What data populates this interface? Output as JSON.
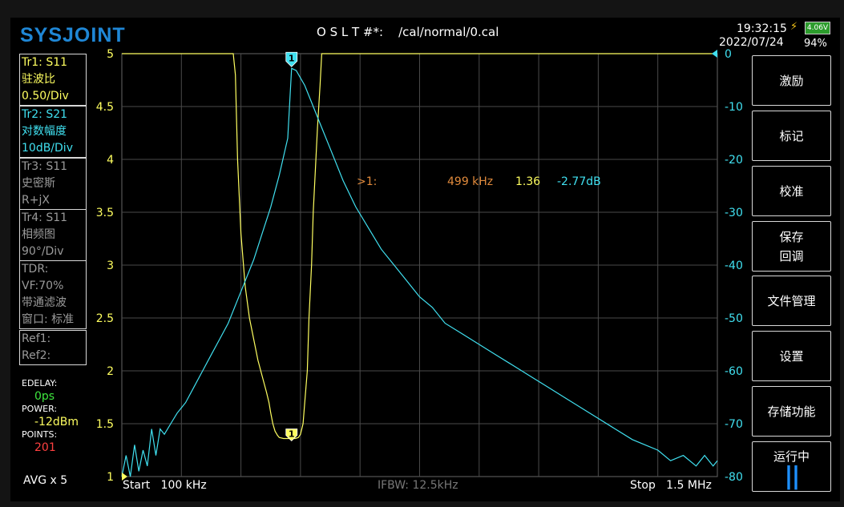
{
  "header": {
    "logo": "SYSJOINT",
    "cal_title": "O S L T #*:    /cal/normal/0.cal",
    "time": "19:32:15",
    "date": "2022/07/24",
    "battery_voltage": "4.06V",
    "battery_percent": "94%"
  },
  "traces": [
    {
      "lines": [
        "Tr1:   S11",
        "驻波比",
        "0.50/Div"
      ],
      "color": "yellow"
    },
    {
      "lines": [
        "Tr2:   S21",
        "对数幅度",
        "10dB/Div"
      ],
      "color": "cyan"
    },
    {
      "lines": [
        "Tr3:   S11",
        "史密斯",
        "R+jX"
      ],
      "color": "grey"
    },
    {
      "lines": [
        "Tr4:   S11",
        "相频图",
        "90°/Div"
      ],
      "color": "grey"
    },
    {
      "lines": [
        "TDR:",
        "VF:70%",
        "带通滤波",
        "窗口: 标准"
      ],
      "color": "grey"
    },
    {
      "lines": [
        "Ref1:",
        "Ref2:"
      ],
      "color": "grey"
    }
  ],
  "settings": {
    "edelay_label": "EDELAY:",
    "edelay_value": "0ps",
    "power_label": "POWER:",
    "power_value": "-12dBm",
    "points_label": "POINTS:",
    "points_value": "201",
    "avg": "AVG x 5"
  },
  "menu": [
    {
      "label": "激励"
    },
    {
      "label": "标记"
    },
    {
      "label": "校准"
    },
    {
      "label": "保存\n回调"
    },
    {
      "label": "文件管理"
    },
    {
      "label": "设置"
    },
    {
      "label": "存储功能"
    },
    {
      "label": "运行中"
    }
  ],
  "run_icon": "pause-icon",
  "footer": {
    "start": "Start   100 kHz",
    "ifbw": "IFBW: 12.5kHz",
    "stop": "Stop   1.5 MHz"
  },
  "chart_data": {
    "type": "line",
    "x_unit": "kHz",
    "xlim": [
      100,
      1500
    ],
    "left_axis": {
      "ticks": [
        "5",
        "4.5",
        "4",
        "3.5",
        "3",
        "2.5",
        "2",
        "1.5",
        "1"
      ],
      "ylim": [
        1,
        5
      ],
      "color": "#ffff60"
    },
    "right_axis": {
      "ticks": [
        "0",
        "-10",
        "-20",
        "-30",
        "-40",
        "-50",
        "-60",
        "-70",
        "-80"
      ],
      "ylim": [
        -80,
        0
      ],
      "color": "#40e0f0"
    },
    "grid": true,
    "series": [
      {
        "name": "Tr1",
        "axis": "left",
        "color": "#ffff60",
        "x": [
          100,
          320,
          355,
          362,
          367,
          372,
          380,
          390,
          400,
          410,
          420,
          430,
          440,
          446,
          450,
          455,
          460,
          466,
          470,
          480,
          490,
          499,
          508,
          515,
          520,
          526,
          530,
          536,
          540,
          546,
          550,
          560,
          566,
          570,
          574,
          580,
          1500
        ],
        "y": [
          5,
          5,
          5,
          5,
          4.8,
          4.0,
          3.3,
          2.8,
          2.5,
          2.3,
          2.1,
          1.95,
          1.8,
          1.7,
          1.6,
          1.5,
          1.43,
          1.39,
          1.37,
          1.36,
          1.36,
          1.36,
          1.36,
          1.37,
          1.4,
          1.5,
          1.7,
          2.0,
          2.5,
          3.0,
          3.5,
          4.3,
          4.7,
          5,
          5,
          5,
          5
        ]
      },
      {
        "name": "Tr2",
        "axis": "right",
        "color": "#40e0f0",
        "x": [
          100,
          110,
          120,
          130,
          140,
          150,
          160,
          170,
          180,
          190,
          200,
          215,
          230,
          250,
          270,
          290,
          310,
          330,
          350,
          370,
          390,
          410,
          430,
          450,
          470,
          490,
          499,
          510,
          530,
          550,
          570,
          590,
          620,
          650,
          680,
          710,
          740,
          770,
          800,
          830,
          860,
          900,
          940,
          980,
          1020,
          1060,
          1100,
          1140,
          1180,
          1220,
          1260,
          1300,
          1330,
          1360,
          1390,
          1420,
          1450,
          1470,
          1490,
          1500
        ],
        "y": [
          -80,
          -76,
          -80,
          -74,
          -79,
          -75,
          -78,
          -71,
          -76,
          -71,
          -72,
          -70,
          -68,
          -66,
          -63,
          -60,
          -57,
          -54,
          -51,
          -47,
          -43,
          -39,
          -34,
          -29,
          -23,
          -16,
          -2.77,
          -3.2,
          -6,
          -10,
          -14,
          -18,
          -24,
          -29,
          -33,
          -37,
          -40,
          -43,
          -46,
          -48,
          -51,
          -53,
          -55,
          -57,
          -59,
          -61,
          -63,
          -65,
          -67,
          -69,
          -71,
          -73,
          -74,
          -75,
          -77,
          -76,
          -78,
          -76,
          -78,
          -77
        ]
      }
    ],
    "markers": [
      {
        "label": "1",
        "x": 499,
        "series": "Tr1",
        "color": "#ffff60"
      },
      {
        "label": "1",
        "x": 499,
        "series": "Tr2",
        "color": "#40e0f0"
      }
    ],
    "readout": {
      "marker": ">1:",
      "freq": "499 kHz",
      "swr": "1.36",
      "db": "-2.77dB"
    }
  }
}
